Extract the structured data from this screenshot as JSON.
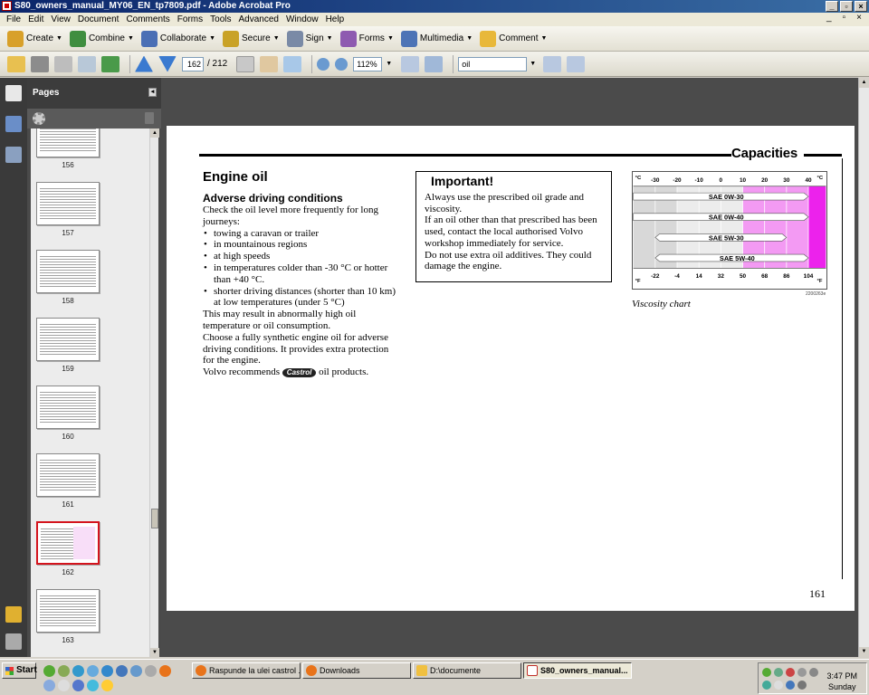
{
  "window": {
    "title": "S80_owners_manual_MY06_EN_tp7809.pdf - Adobe Acrobat Pro",
    "controls": [
      "_",
      "▫",
      "×"
    ],
    "doc_controls": [
      "_",
      "▫",
      "×"
    ]
  },
  "menu": [
    "File",
    "Edit",
    "View",
    "Document",
    "Comments",
    "Forms",
    "Tools",
    "Advanced",
    "Window",
    "Help"
  ],
  "toolbar_tasks": [
    {
      "label": "Create",
      "color": "#d8a02a"
    },
    {
      "label": "Combine",
      "color": "#3f8e3f"
    },
    {
      "label": "Collaborate",
      "color": "#4a6fb5"
    },
    {
      "label": "Secure",
      "color": "#c9a227"
    },
    {
      "label": "Sign",
      "color": "#7a8aa6"
    },
    {
      "label": "Forms",
      "color": "#8e5ab0"
    },
    {
      "label": "Multimedia",
      "color": "#4d74b6"
    },
    {
      "label": "Comment",
      "color": "#e8b83a"
    }
  ],
  "nav": {
    "current_page": "162",
    "total_pages": "/ 212",
    "zoom": "112%",
    "search_value": "oil"
  },
  "sidebar": {
    "title": "Pages",
    "thumbs": [
      {
        "label": "156"
      },
      {
        "label": "157"
      },
      {
        "label": "158"
      },
      {
        "label": "159"
      },
      {
        "label": "160"
      },
      {
        "label": "161"
      },
      {
        "label": "162",
        "selected": true
      },
      {
        "label": "163"
      }
    ]
  },
  "doc": {
    "section_title": "Capacities",
    "heading": "Engine oil",
    "subheading": "Adverse driving conditions",
    "intro": "Check the oil level more frequently for long journeys:",
    "bullets": [
      "towing a caravan or trailer",
      "in mountainous regions",
      "at high speeds",
      "in temperatures colder than -30 °C or hotter than +40 °C.",
      "shorter driving distances (shorter than 10 km) at low temperatures (under 5 °C)"
    ],
    "para1": "This may result in abnormally high oil temperature or oil consumption.",
    "para2": "Choose a fully synthetic engine oil for adverse driving conditions. It provides extra protection for the engine.",
    "recommend_prefix": "Volvo recommends",
    "castrol": "Castrol",
    "recommend_suffix": "oil products.",
    "important_title": "Important!",
    "important_lines": [
      "Always use the prescribed oil grade and viscosity.",
      "If an oil other than that prescribed has been used, contact the local authorised Volvo workshop immediately for service.",
      "Do not use extra oil additives. They could damage the engine."
    ],
    "chart_caption": "Viscosity chart",
    "chart_id": "2200263e",
    "page_number": "161"
  },
  "chart_data": {
    "type": "bar",
    "title": "",
    "unit_top_left": "°C",
    "unit_top_right": "°C",
    "unit_bottom_left": "°F",
    "unit_bottom_right": "°F",
    "celsius_ticks": [
      "-30",
      "-20",
      "-10",
      "0",
      "10",
      "20",
      "30",
      "40"
    ],
    "fahrenheit_ticks": [
      "-22",
      "-4",
      "14",
      "32",
      "50",
      "68",
      "86",
      "104"
    ],
    "xlim": [
      -40,
      48
    ],
    "series": [
      {
        "name": "SAE 0W-30",
        "start": -40,
        "end": 40
      },
      {
        "name": "SAE 0W-40",
        "start": -40,
        "end": 40
      },
      {
        "name": "SAE 5W-30",
        "start": -30,
        "end": 30
      },
      {
        "name": "SAE 5W-40",
        "start": -30,
        "end": 40
      }
    ],
    "colors": {
      "cold_band": "#d8d8d8",
      "warm_band": "#f39af3",
      "hot_band": "#ec22ec"
    }
  },
  "taskbar": {
    "start": "Start",
    "tasks": [
      {
        "label": "Raspunde la ulei castrol ...",
        "color": "#e8731a",
        "active": false
      },
      {
        "label": "Downloads",
        "color": "#e8731a",
        "active": false
      },
      {
        "label": "D:\\documente",
        "color": "#f0c040",
        "active": false
      },
      {
        "label": "S80_owners_manual...",
        "color": "#c0302a",
        "active": true
      }
    ],
    "time": "3:47 PM",
    "day": "Sunday"
  }
}
